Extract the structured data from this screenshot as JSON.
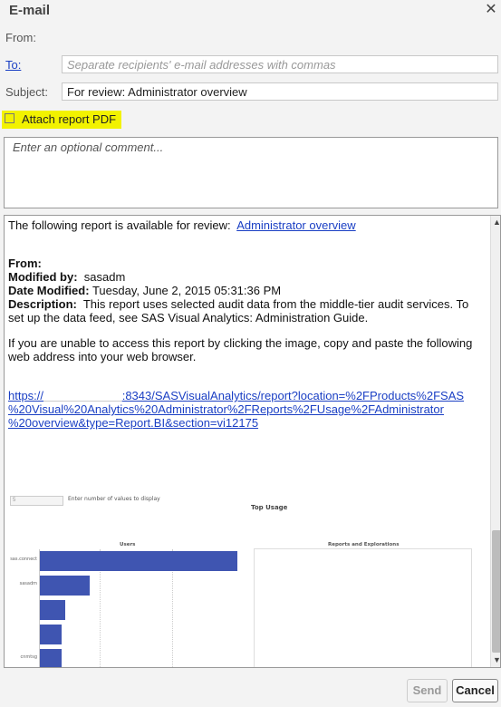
{
  "dialog": {
    "title": "E-mail"
  },
  "form": {
    "from_label": "From:",
    "from_value": "                   ",
    "to_label": "To:",
    "to_placeholder": "Separate recipients' e-mail addresses with commas",
    "subject_label": "Subject:",
    "subject_value": "For review: Administrator overview",
    "attach_label": "Attach report PDF",
    "attach_checked": false,
    "comment_placeholder": "Enter an optional comment..."
  },
  "preview": {
    "intro": "The following report is available for review:",
    "report_link": "Administrator overview",
    "from_label": "From:",
    "modified_by_label": "Modified by:",
    "modified_by": "sasadm",
    "date_modified_label": "Date Modified:",
    "date_modified": "Tuesday, June 2, 2015 05:31:36 PM",
    "description_label": "Description:",
    "description_line1": "This report uses selected audit data from the middle-tier audit services.  To",
    "description_line2": "set up the data feed, see SAS Visual Analytics: Administration Guide.",
    "access_line1": "If you are unable to access this report by clicking the image, copy and paste the following",
    "access_line2": "web address into your web browser.",
    "url_line1": "https://",
    "url_line1b": ":8343/SASVisualAnalytics/report?location=%2FProducts%2FSAS",
    "url_line2": "%20Visual%20Analytics%20Administrator%2FReports%2FUsage%2FAdministrator",
    "url_line3": "%20overview&type=Report.BI&section=vi12175"
  },
  "thumbnail": {
    "input_value": "5",
    "input_hint": "Enter number of values to display",
    "title": "Top Usage",
    "users_title": "Users",
    "reports_title": "Reports and Explorations",
    "bar_labels": [
      "sas.connect",
      "sasadm",
      "",
      "",
      "cnmtsg"
    ],
    "bar_values": [
      1.0,
      0.25,
      0.13,
      0.11,
      0.11
    ],
    "bar_color": "#3f55b1"
  },
  "buttons": {
    "send": "Send",
    "cancel": "Cancel"
  }
}
